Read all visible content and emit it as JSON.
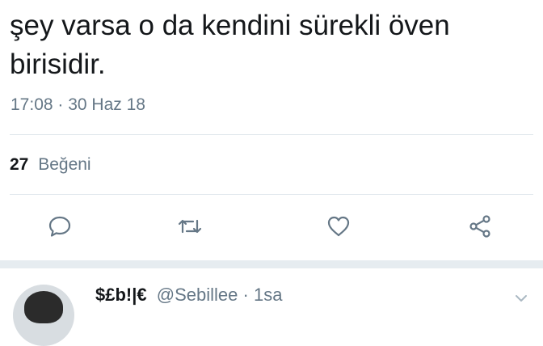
{
  "tweet": {
    "text_line1": "şey varsa o da kendini sürekli öven",
    "text_line2": "birisidir.",
    "timestamp": "17:08 · 30 Haz 18",
    "likes_count": "27",
    "likes_label": "Beğeni"
  },
  "actions": [
    {
      "icon": "reply-icon"
    },
    {
      "icon": "retweet-icon"
    },
    {
      "icon": "like-icon"
    },
    {
      "icon": "share-icon"
    }
  ],
  "reply": {
    "name": "$£b!|€",
    "handle": "@Sebillee",
    "separator": "·",
    "time": "1sa"
  },
  "colors": {
    "text": "#14171a",
    "secondary": "#657786",
    "divider": "#e1e8ed",
    "separator_bg": "#e6ecf0"
  }
}
